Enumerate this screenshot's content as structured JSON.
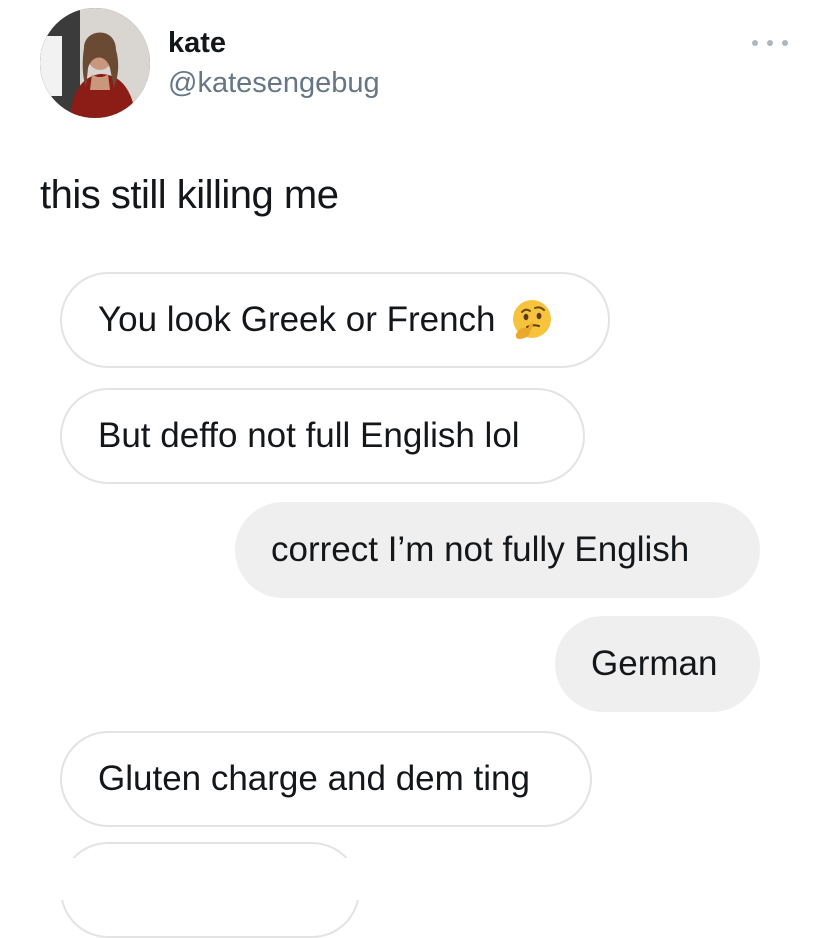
{
  "tweet": {
    "display_name": "kate",
    "handle": "@katesengebug",
    "text": "this still killing me",
    "more_icon": "more-horizontal-icon"
  },
  "messages": [
    {
      "side": "incoming",
      "text": "You look Greek or French",
      "emoji": "thinking-face-icon"
    },
    {
      "side": "incoming",
      "text": "But deffo not full English lol"
    },
    {
      "side": "outgoing",
      "text": "correct I’m not fully English"
    },
    {
      "side": "outgoing",
      "text": "German"
    },
    {
      "side": "incoming",
      "text": "Gluten charge and dem ting"
    }
  ],
  "colors": {
    "text": "#14171a",
    "handle": "#657786",
    "incoming_bubble_border": "#e3e3e3",
    "outgoing_bubble_bg": "#efefef",
    "emoji_yellow": "#f7c33c"
  }
}
